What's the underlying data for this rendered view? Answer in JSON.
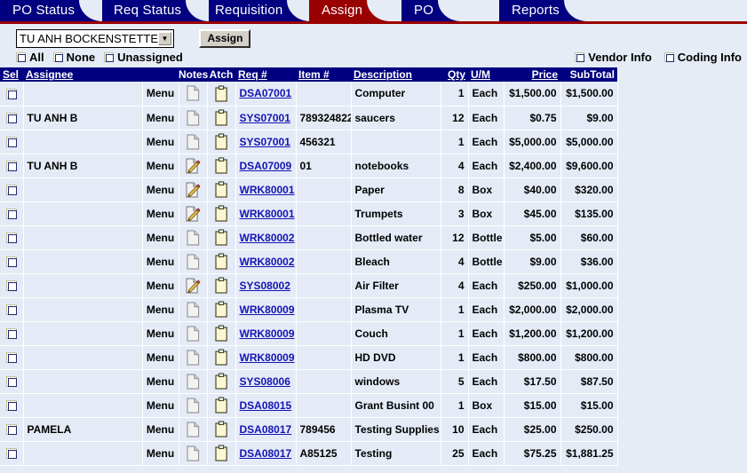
{
  "tabs": [
    {
      "label": "PO Status",
      "active": false
    },
    {
      "label": "Req Status",
      "active": false
    },
    {
      "label": "Requisition",
      "active": false
    },
    {
      "label": "Assign",
      "active": true
    },
    {
      "label": "PO",
      "active": false
    },
    {
      "label": "Reports",
      "active": false
    }
  ],
  "colors": {
    "tab_inactive": "#000080",
    "tab_active": "#990000",
    "rule": "#990000",
    "page_bg": "#e6ecf5",
    "row_bg": "#e4ebf6",
    "link": "#1414b4"
  },
  "toolbar": {
    "assignee_select_value": "TU ANH BOCKENSTETTE",
    "assignee_select_placeholder": "TU ANH BOCKENSTETTE",
    "dropdown_arrow_glyph": "▼",
    "assign_button_label": "Assign"
  },
  "filters": {
    "left": [
      {
        "label": "All",
        "checked": false
      },
      {
        "label": "None",
        "checked": false
      },
      {
        "label": "Unassigned",
        "checked": false
      }
    ],
    "right": [
      {
        "label": "Vendor Info",
        "checked": false
      },
      {
        "label": "Coding Info",
        "checked": false
      }
    ]
  },
  "table": {
    "headers": [
      {
        "label": "Sel",
        "underline": true,
        "key": "sel"
      },
      {
        "label": "Assignee",
        "underline": true,
        "key": "asg"
      },
      {
        "label": "",
        "underline": false,
        "key": "menu"
      },
      {
        "label": "Notes",
        "underline": false,
        "key": "notes"
      },
      {
        "label": "Atch",
        "underline": false,
        "key": "atch"
      },
      {
        "label": "Req #",
        "underline": true,
        "key": "req"
      },
      {
        "label": "Item #",
        "underline": true,
        "key": "item"
      },
      {
        "label": "Description",
        "underline": true,
        "key": "desc"
      },
      {
        "label": "Qty",
        "underline": true,
        "key": "qty"
      },
      {
        "label": "U/M",
        "underline": true,
        "key": "um"
      },
      {
        "label": "Price",
        "underline": true,
        "key": "price"
      },
      {
        "label": "SubTotal",
        "underline": false,
        "key": "sub"
      }
    ],
    "menu_label": "Menu",
    "rows": [
      {
        "sel": false,
        "assignee": "",
        "notes": "page",
        "atch": "clipboard",
        "req": "DSA07001",
        "item": "",
        "desc": "Computer",
        "qty": "1",
        "um": "Each",
        "price": "$1,500.00",
        "subtotal": "$1,500.00"
      },
      {
        "sel": false,
        "assignee": "TU ANH B",
        "notes": "page",
        "atch": "clipboard",
        "req": "SYS07001",
        "item": "789324822",
        "desc": "saucers",
        "qty": "12",
        "um": "Each",
        "price": "$0.75",
        "subtotal": "$9.00"
      },
      {
        "sel": false,
        "assignee": "",
        "notes": "page",
        "atch": "clipboard",
        "req": "SYS07001",
        "item": "456321",
        "desc": "",
        "qty": "1",
        "um": "Each",
        "price": "$5,000.00",
        "subtotal": "$5,000.00"
      },
      {
        "sel": false,
        "assignee": "TU ANH B",
        "notes": "page-pencil",
        "atch": "clipboard",
        "req": "DSA07009",
        "item": "01",
        "desc": "notebooks",
        "qty": "4",
        "um": "Each",
        "price": "$2,400.00",
        "subtotal": "$9,600.00"
      },
      {
        "sel": false,
        "assignee": "",
        "notes": "page-pencil",
        "atch": "clipboard",
        "req": "WRK80001",
        "item": "",
        "desc": "Paper",
        "qty": "8",
        "um": "Box",
        "price": "$40.00",
        "subtotal": "$320.00"
      },
      {
        "sel": false,
        "assignee": "",
        "notes": "page-pencil",
        "atch": "clipboard",
        "req": "WRK80001",
        "item": "",
        "desc": "Trumpets",
        "qty": "3",
        "um": "Box",
        "price": "$45.00",
        "subtotal": "$135.00"
      },
      {
        "sel": false,
        "assignee": "",
        "notes": "page",
        "atch": "clipboard",
        "req": "WRK80002",
        "item": "",
        "desc": "Bottled water",
        "qty": "12",
        "um": "Bottle",
        "price": "$5.00",
        "subtotal": "$60.00"
      },
      {
        "sel": false,
        "assignee": "",
        "notes": "page",
        "atch": "clipboard",
        "req": "WRK80002",
        "item": "",
        "desc": "Bleach",
        "qty": "4",
        "um": "Bottle",
        "price": "$9.00",
        "subtotal": "$36.00"
      },
      {
        "sel": false,
        "assignee": "",
        "notes": "page-pencil",
        "atch": "clipboard",
        "req": "SYS08002",
        "item": "",
        "desc": "Air Filter",
        "qty": "4",
        "um": "Each",
        "price": "$250.00",
        "subtotal": "$1,000.00"
      },
      {
        "sel": false,
        "assignee": "",
        "notes": "page",
        "atch": "clipboard",
        "req": "WRK80009",
        "item": "",
        "desc": "Plasma TV",
        "qty": "1",
        "um": "Each",
        "price": "$2,000.00",
        "subtotal": "$2,000.00"
      },
      {
        "sel": false,
        "assignee": "",
        "notes": "page",
        "atch": "clipboard",
        "req": "WRK80009",
        "item": "",
        "desc": "Couch",
        "qty": "1",
        "um": "Each",
        "price": "$1,200.00",
        "subtotal": "$1,200.00"
      },
      {
        "sel": false,
        "assignee": "",
        "notes": "page",
        "atch": "clipboard",
        "req": "WRK80009",
        "item": "",
        "desc": "HD DVD",
        "qty": "1",
        "um": "Each",
        "price": "$800.00",
        "subtotal": "$800.00"
      },
      {
        "sel": false,
        "assignee": "",
        "notes": "page",
        "atch": "clipboard",
        "req": "SYS08006",
        "item": "",
        "desc": "windows",
        "qty": "5",
        "um": "Each",
        "price": "$17.50",
        "subtotal": "$87.50"
      },
      {
        "sel": false,
        "assignee": "",
        "notes": "page",
        "atch": "clipboard",
        "req": "DSA08015",
        "item": "",
        "desc": "Grant Busint 00",
        "qty": "1",
        "um": "Box",
        "price": "$15.00",
        "subtotal": "$15.00"
      },
      {
        "sel": false,
        "assignee": "PAMELA",
        "notes": "page",
        "atch": "clipboard",
        "req": "DSA08017",
        "item": "789456",
        "desc": "Testing Supplies",
        "qty": "10",
        "um": "Each",
        "price": "$25.00",
        "subtotal": "$250.00"
      },
      {
        "sel": false,
        "assignee": "",
        "notes": "page",
        "atch": "clipboard",
        "req": "DSA08017",
        "item": "A85125",
        "desc": "Testing",
        "qty": "25",
        "um": "Each",
        "price": "$75.25",
        "subtotal": "$1,881.25"
      }
    ]
  }
}
